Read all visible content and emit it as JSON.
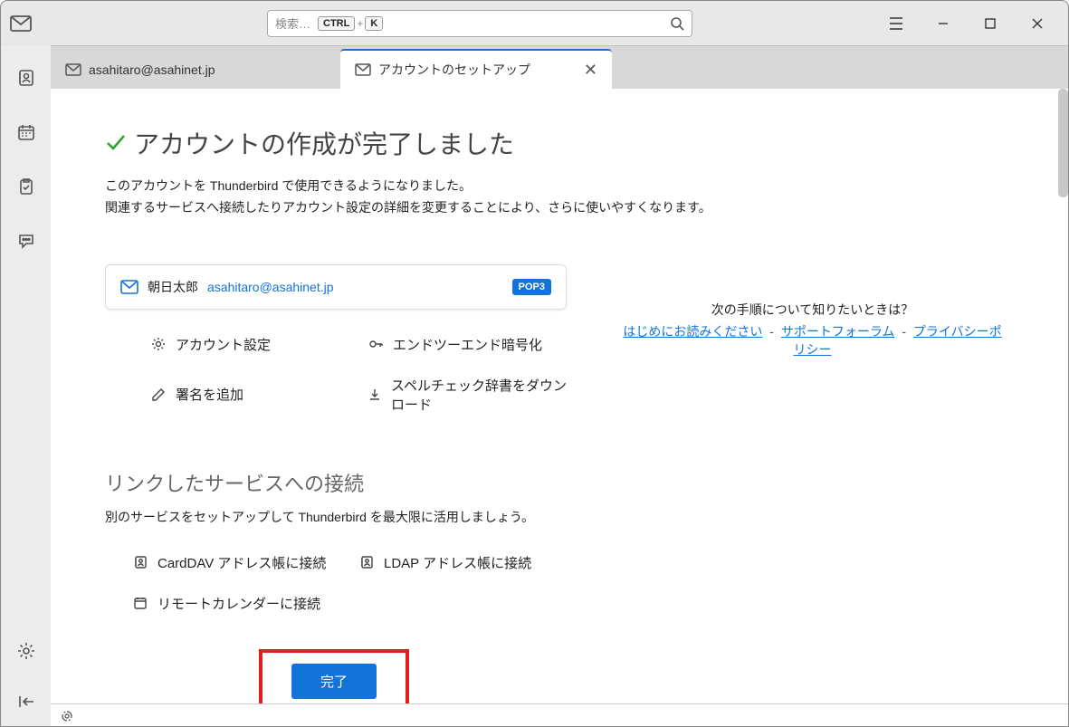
{
  "search": {
    "placeholder": "検索…",
    "kbd1": "CTRL",
    "plus": "+",
    "kbd2": "K"
  },
  "tabs": {
    "account": "asahitaro@asahinet.jp",
    "setup": "アカウントのセットアップ"
  },
  "page": {
    "title": "アカウントの作成が完了しました",
    "desc1": "このアカウントを Thunderbird で使用できるようになりました。",
    "desc2": "関連するサービスへ接続したりアカウント設定の詳細を変更することにより、さらに使いやすくなります。"
  },
  "account": {
    "display_name": "朝日太郎",
    "email": "asahitaro@asahinet.jp",
    "protocol": "POP3"
  },
  "actions": {
    "settings": "アカウント設定",
    "e2e": "エンドツーエンド暗号化",
    "signature": "署名を追加",
    "dict": "スペルチェック辞書をダウンロード"
  },
  "help": {
    "question": "次の手順について知りたいときは？",
    "link1": "はじめにお読みください",
    "link2": "サポートフォーラム",
    "link3": "プライバシーポリシー",
    "sep": "-"
  },
  "services": {
    "title": "リンクしたサービスへの接続",
    "desc": "別のサービスをセットアップして Thunderbird を最大限に活用しましょう。",
    "carddav": "CardDAV アドレス帳に接続",
    "ldap": "LDAP アドレス帳に接続",
    "calendar": "リモートカレンダーに接続"
  },
  "done": "完了"
}
